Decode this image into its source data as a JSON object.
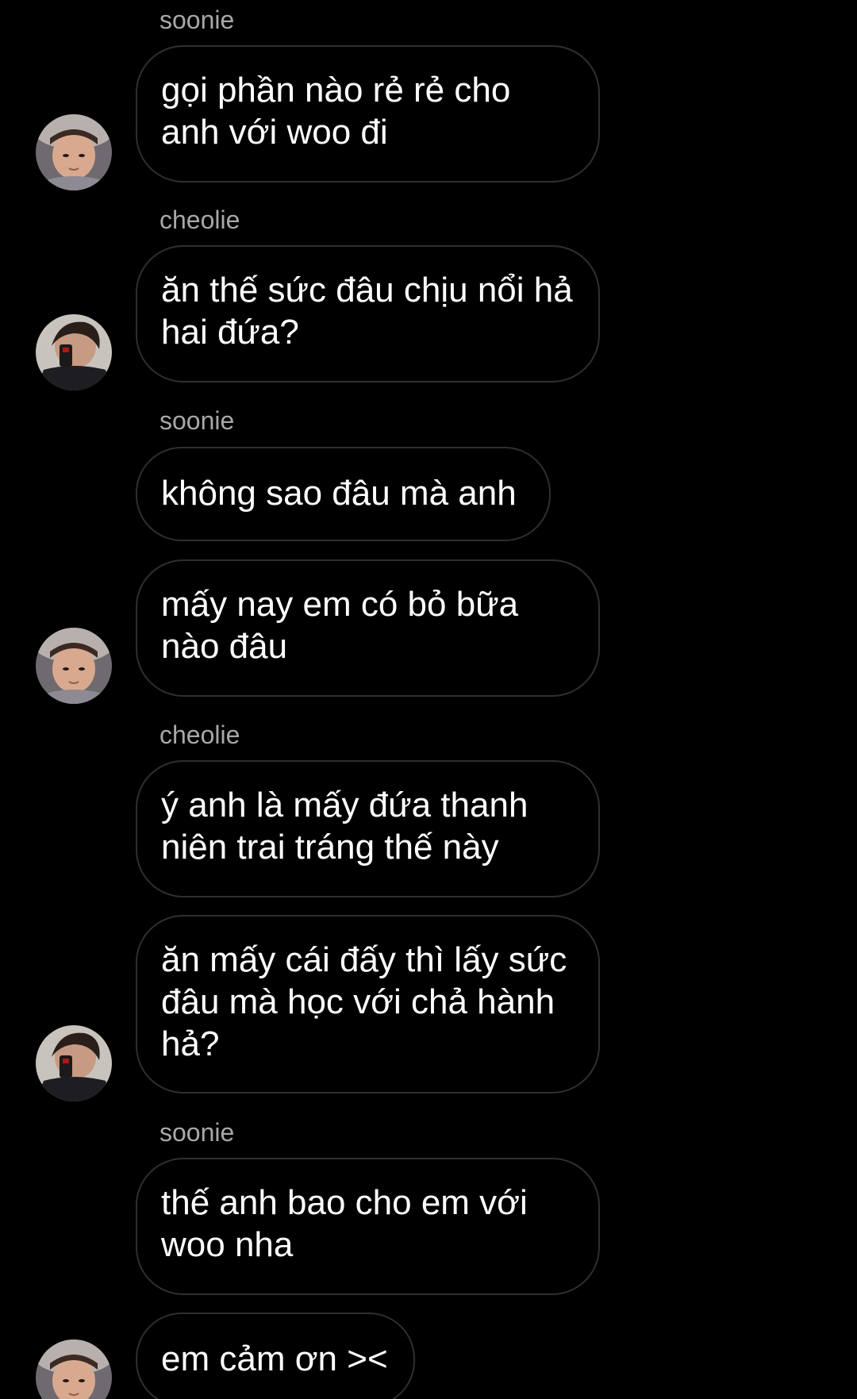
{
  "chat": {
    "messages": [
      {
        "sender": "soonie",
        "text": "gọi phần nào rẻ rẻ cho anh với woo đi"
      },
      {
        "sender": "cheolie",
        "text": "ăn thế sức đâu chịu nổi hả hai đứa?"
      },
      {
        "sender": "soonie",
        "text": "không sao đâu mà anh"
      },
      {
        "sender": "",
        "text": "mấy nay em có bỏ bữa nào đâu"
      },
      {
        "sender": "cheolie",
        "text": "ý anh là mấy đứa thanh niên trai tráng thế này"
      },
      {
        "sender": "",
        "text": "ăn mấy cái đấy thì lấy sức đâu mà học với chả hành hả?"
      },
      {
        "sender": "soonie",
        "text": "thế anh bao cho em với woo nha"
      },
      {
        "sender": "",
        "text": "em cảm ơn ><"
      }
    ],
    "avatars": {
      "soonie": "avatar-soonie",
      "cheolie": "avatar-cheolie"
    }
  },
  "colors": {
    "background": "#000000",
    "bubble_border": "#2f2f2f",
    "sender_name": "#a8a8a8",
    "message_text": "#ffffff"
  }
}
